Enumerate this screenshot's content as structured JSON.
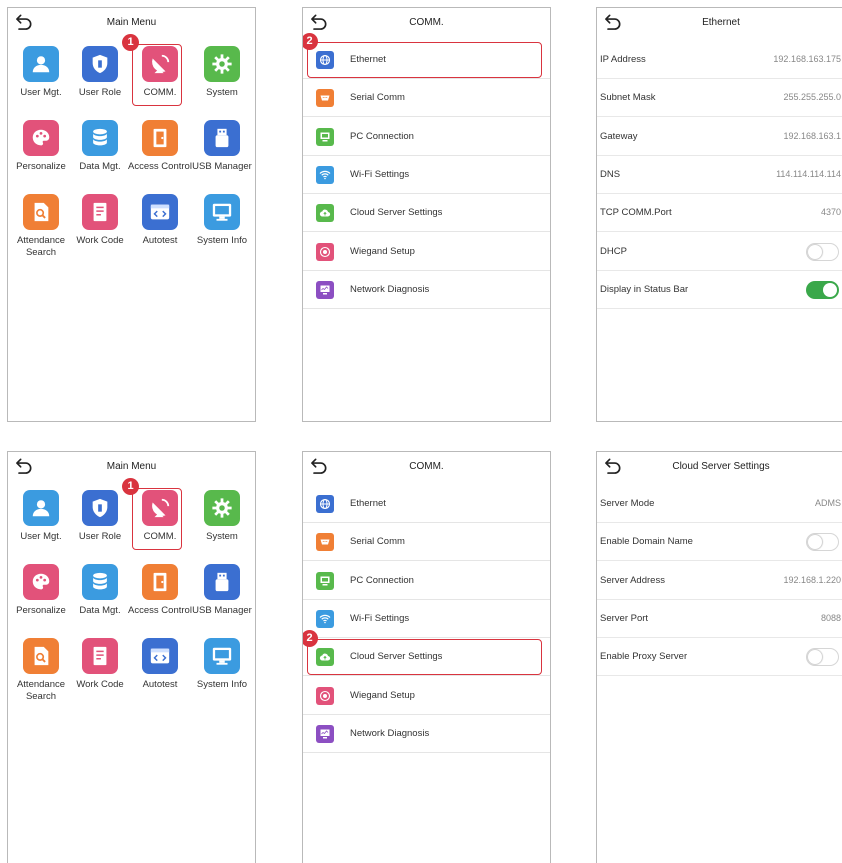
{
  "colors": {
    "highlight": "#d9343f",
    "toggle_on": "#3aa84a",
    "tile_blue": "#3b6fd1",
    "tile_cyan": "#3b9be0",
    "tile_pink": "#e2527a",
    "tile_green": "#58b94c",
    "tile_orange": "#f07f35",
    "tile_purple": "#8c4fc2"
  },
  "main_menu": {
    "title": "Main Menu",
    "items": [
      {
        "label": "User Mgt.",
        "icon": "user-icon",
        "color": "#3b9be0"
      },
      {
        "label": "User Role",
        "icon": "shield-user-icon",
        "color": "#3b6fd1"
      },
      {
        "label": "COMM.",
        "icon": "satellite-dish-icon",
        "color": "#e2527a"
      },
      {
        "label": "System",
        "icon": "gear-icon",
        "color": "#58b94c"
      },
      {
        "label": "Personalize",
        "icon": "palette-icon",
        "color": "#e2527a"
      },
      {
        "label": "Data Mgt.",
        "icon": "database-icon",
        "color": "#3b9be0"
      },
      {
        "label": "Access Control",
        "icon": "door-icon",
        "color": "#f07f35"
      },
      {
        "label": "USB Manager",
        "icon": "usb-icon",
        "color": "#3b6fd1"
      },
      {
        "label": "Attendance Search",
        "icon": "document-search-icon",
        "color": "#f07f35"
      },
      {
        "label": "Work Code",
        "icon": "notebook-icon",
        "color": "#e2527a"
      },
      {
        "label": "Autotest",
        "icon": "code-window-icon",
        "color": "#3b6fd1"
      },
      {
        "label": "System Info",
        "icon": "monitor-icon",
        "color": "#3b9be0"
      }
    ]
  },
  "comm_menu": {
    "title": "COMM.",
    "items": [
      {
        "label": "Ethernet",
        "icon": "globe-icon",
        "color": "#3b6fd1"
      },
      {
        "label": "Serial Comm",
        "icon": "serial-port-icon",
        "color": "#f07f35"
      },
      {
        "label": "PC Connection",
        "icon": "pc-icon",
        "color": "#58b94c"
      },
      {
        "label": "Wi-Fi Settings",
        "icon": "wifi-icon",
        "color": "#3b9be0"
      },
      {
        "label": "Cloud Server Settings",
        "icon": "cloud-icon",
        "color": "#58b94c"
      },
      {
        "label": "Wiegand Setup",
        "icon": "wiegand-icon",
        "color": "#e2527a"
      },
      {
        "label": "Network Diagnosis",
        "icon": "network-diagnosis-icon",
        "color": "#8c4fc2"
      }
    ]
  },
  "steps": {
    "one": "1",
    "two": "2"
  },
  "ethernet": {
    "title": "Ethernet",
    "rows": [
      {
        "label": "IP Address",
        "value": "192.168.163.175"
      },
      {
        "label": "Subnet Mask",
        "value": "255.255.255.0"
      },
      {
        "label": "Gateway",
        "value": "192.168.163.1"
      },
      {
        "label": "DNS",
        "value": "114.114.114.114"
      },
      {
        "label": "TCP COMM.Port",
        "value": "4370"
      },
      {
        "label": "DHCP",
        "toggle": false
      },
      {
        "label": "Display in Status Bar",
        "toggle": true
      }
    ]
  },
  "cloud": {
    "title": "Cloud Server Settings",
    "rows": [
      {
        "label": "Server Mode",
        "value": "ADMS"
      },
      {
        "label": "Enable Domain Name",
        "toggle": false
      },
      {
        "label": "Server Address",
        "value": "192.168.1.220"
      },
      {
        "label": "Server Port",
        "value": "8088"
      },
      {
        "label": "Enable Proxy Server",
        "toggle": false
      }
    ]
  }
}
